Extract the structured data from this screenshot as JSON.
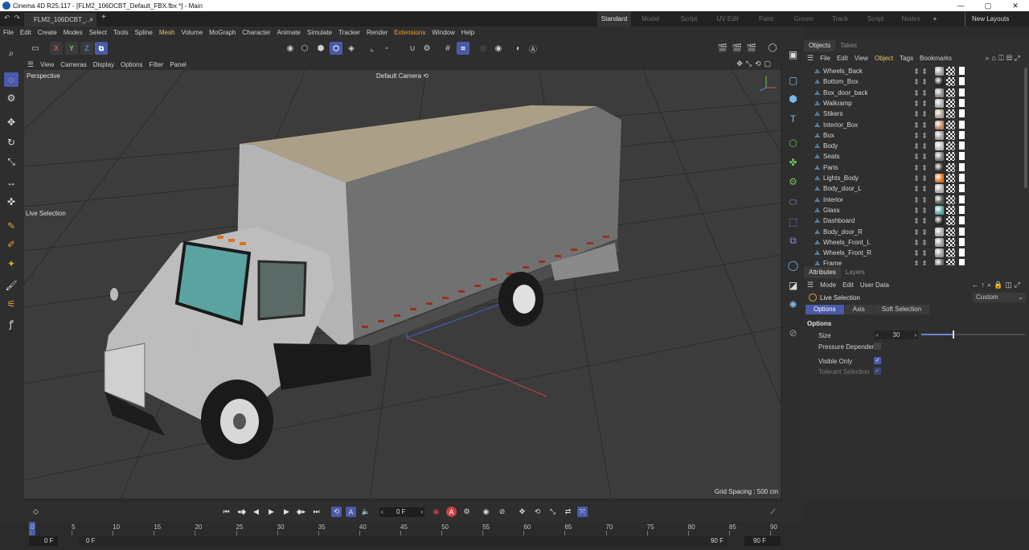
{
  "window": {
    "title": "Cinema 4D R25.117 - [FLM2_106DCBT_Default_FBX.fbx *] - Main",
    "minimize": "—",
    "maximize": "▢",
    "close": "✕"
  },
  "tabs": {
    "document": "FLM2_106DCBT_...",
    "close": "×",
    "add": "+",
    "layouts": [
      "Standard",
      "Model",
      "Script",
      "UV Edit",
      "Paint",
      "Groom",
      "Track",
      "Script",
      "Nodes"
    ],
    "active_layout": "Standard",
    "add_layout": "+",
    "new_layouts": "New Layouts"
  },
  "menubar": [
    "File",
    "Edit",
    "Create",
    "Modes",
    "Select",
    "Tools",
    "Spline",
    "Mesh",
    "Volume",
    "MoGraph",
    "Character",
    "Animate",
    "Simulate",
    "Tracker",
    "Render",
    "Extensions",
    "Window",
    "Help"
  ],
  "toolbar": {
    "axis_x": "X",
    "axis_y": "Y",
    "axis_z": "Z"
  },
  "viewport": {
    "menu": [
      "View",
      "Cameras",
      "Display",
      "Options",
      "Filter",
      "Panel"
    ],
    "view_name": "Perspective",
    "camera": "Default Camera",
    "camera_icon": "⟲",
    "tool_label": "Live Selection",
    "grid_spacing": "Grid Spacing : 500 cm"
  },
  "objects_panel": {
    "tabs": [
      "Objects",
      "Takes"
    ],
    "menu": [
      "File",
      "Edit",
      "View",
      "Object",
      "Tags",
      "Bookmarks"
    ],
    "active_menu": "Object",
    "items": [
      {
        "name": "Wheels_Back",
        "mat": "#9a9a9a"
      },
      {
        "name": "Bottom_Box",
        "mat": "#222222"
      },
      {
        "name": "Box_door_back",
        "mat": "#8a8a8a"
      },
      {
        "name": "Walkramp",
        "mat": "#aaaaaa"
      },
      {
        "name": "Stikers",
        "mat": "#b0a090"
      },
      {
        "name": "Interior_Box",
        "mat": "#c08060"
      },
      {
        "name": "Box",
        "mat": "#9a9a9a"
      },
      {
        "name": "Body",
        "mat": "#bbbbbb"
      },
      {
        "name": "Seats",
        "mat": "#777777"
      },
      {
        "name": "Parts",
        "mat": "#303030"
      },
      {
        "name": "Lights_Body",
        "mat": "#e07020"
      },
      {
        "name": "Body_door_L",
        "mat": "#aaaaaa"
      },
      {
        "name": "Interior",
        "mat": "#555555"
      },
      {
        "name": "Glass",
        "mat": "#5aa6a0"
      },
      {
        "name": "Dashboard",
        "mat": "#222222"
      },
      {
        "name": "Body_door_R",
        "mat": "#aaaaaa"
      },
      {
        "name": "Wheels_Front_L",
        "mat": "#9a9a9a"
      },
      {
        "name": "Wheels_Front_R",
        "mat": "#9a9a9a"
      },
      {
        "name": "Frame",
        "mat": "#666666"
      }
    ]
  },
  "attributes_panel": {
    "tabs": [
      "Attributes",
      "Layers"
    ],
    "menu": [
      "Mode",
      "Edit",
      "User Data"
    ],
    "tool_name": "Live Selection",
    "preset": "Custom",
    "subtabs": [
      "Options",
      "Axis",
      "Soft Selection"
    ],
    "active_subtab": "Options",
    "section": "Options",
    "size_label": "Size",
    "size_value": "30",
    "size_fraction": 0.3,
    "pressure_label": "Pressure Dependent",
    "visible_only_label": "Visible Only",
    "tolerant_label": "Tolerant Selection",
    "check_mark": "✓"
  },
  "timeline": {
    "current_frame": "0 F",
    "ticks": [
      "0",
      "5",
      "10",
      "15",
      "20",
      "25",
      "30",
      "35",
      "40",
      "45",
      "50",
      "55",
      "60",
      "65",
      "70",
      "75",
      "80",
      "85",
      "90"
    ],
    "start_field": "0 F",
    "preview_start": "0 F",
    "preview_end": "90 F",
    "end_field": "90 F"
  },
  "colors": {
    "accent": "#4b5aa8",
    "menu_highlight": "#e2c864",
    "extensions": "#f0a020",
    "axis_x": "#e05050",
    "axis_y": "#70c050",
    "axis_z": "#5080e0"
  }
}
